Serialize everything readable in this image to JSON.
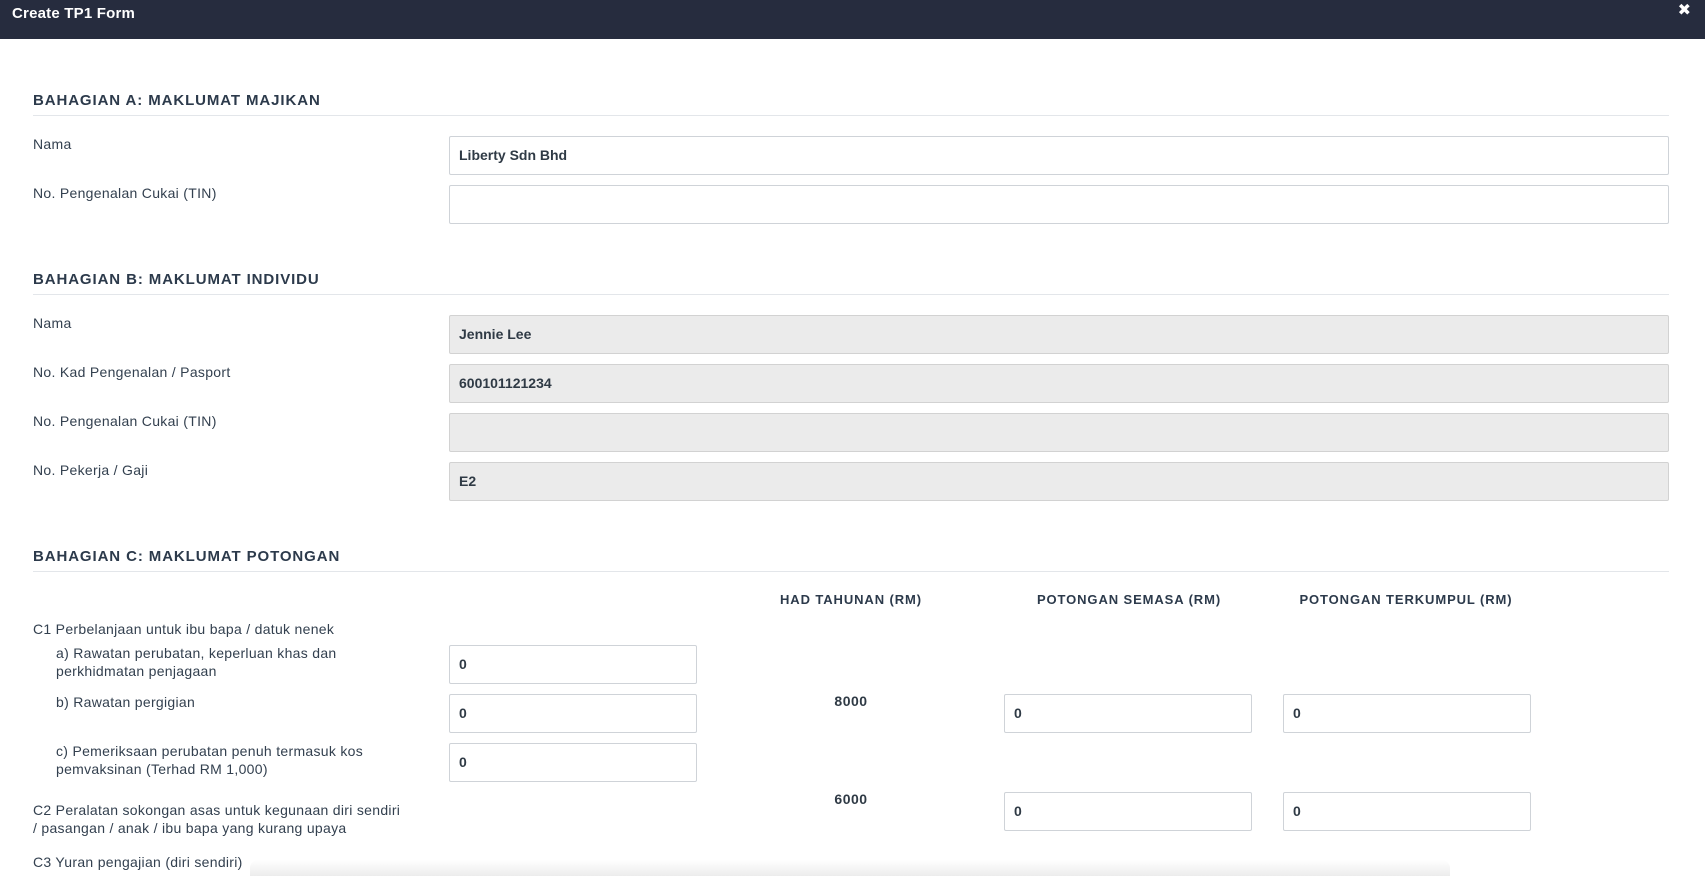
{
  "modal": {
    "title": "Create TP1 Form",
    "close_glyph": "✖"
  },
  "section_a": {
    "title": "BAHAGIAN A: MAKLUMAT MAJIKAN",
    "fields": [
      {
        "label": "Nama",
        "value": "Liberty Sdn Bhd",
        "readonly": false
      },
      {
        "label": "No. Pengenalan Cukai (TIN)",
        "value": "",
        "readonly": false
      }
    ]
  },
  "section_b": {
    "title": "BAHAGIAN B: MAKLUMAT INDIVIDU",
    "fields": [
      {
        "label": "Nama",
        "value": "Jennie Lee",
        "readonly": true
      },
      {
        "label": "No. Kad Pengenalan / Pasport",
        "value": "600101121234",
        "readonly": true
      },
      {
        "label": "No. Pengenalan Cukai (TIN)",
        "value": "",
        "readonly": true
      },
      {
        "label": "No. Pekerja / Gaji",
        "value": "E2",
        "readonly": true
      }
    ]
  },
  "section_c": {
    "title": "BAHAGIAN C: MAKLUMAT POTONGAN",
    "columns": {
      "annual_limit": "HAD TAHUNAN (RM)",
      "current_deduction": "POTONGAN SEMASA (RM)",
      "accumulated_deduction": "POTONGAN TERKUMPUL (RM)"
    },
    "c1": {
      "label": "C1 Perbelanjaan untuk ibu bapa / datuk nenek",
      "items": [
        {
          "label_line1": "a) Rawatan perubatan, keperluan khas dan",
          "label_line2": "perkhidmatan penjagaan",
          "value": "0"
        },
        {
          "label_line1": "b) Rawatan pergigian",
          "label_line2": "",
          "value": "0"
        },
        {
          "label_line1": "c) Pemeriksaan perubatan penuh termasuk kos",
          "label_line2": "pemvaksinan (Terhad RM 1,000)",
          "value": "0"
        }
      ],
      "limit": "8000",
      "current": "0",
      "accumulated": "0"
    },
    "c2": {
      "label_line1": "C2 Peralatan sokongan asas untuk kegunaan diri sendiri",
      "label_line2": "/ pasangan / anak / ibu bapa yang kurang upaya",
      "limit": "6000",
      "current": "0",
      "accumulated": "0"
    },
    "c3": {
      "label": "C3 Yuran pengajian (diri sendiri)"
    }
  }
}
